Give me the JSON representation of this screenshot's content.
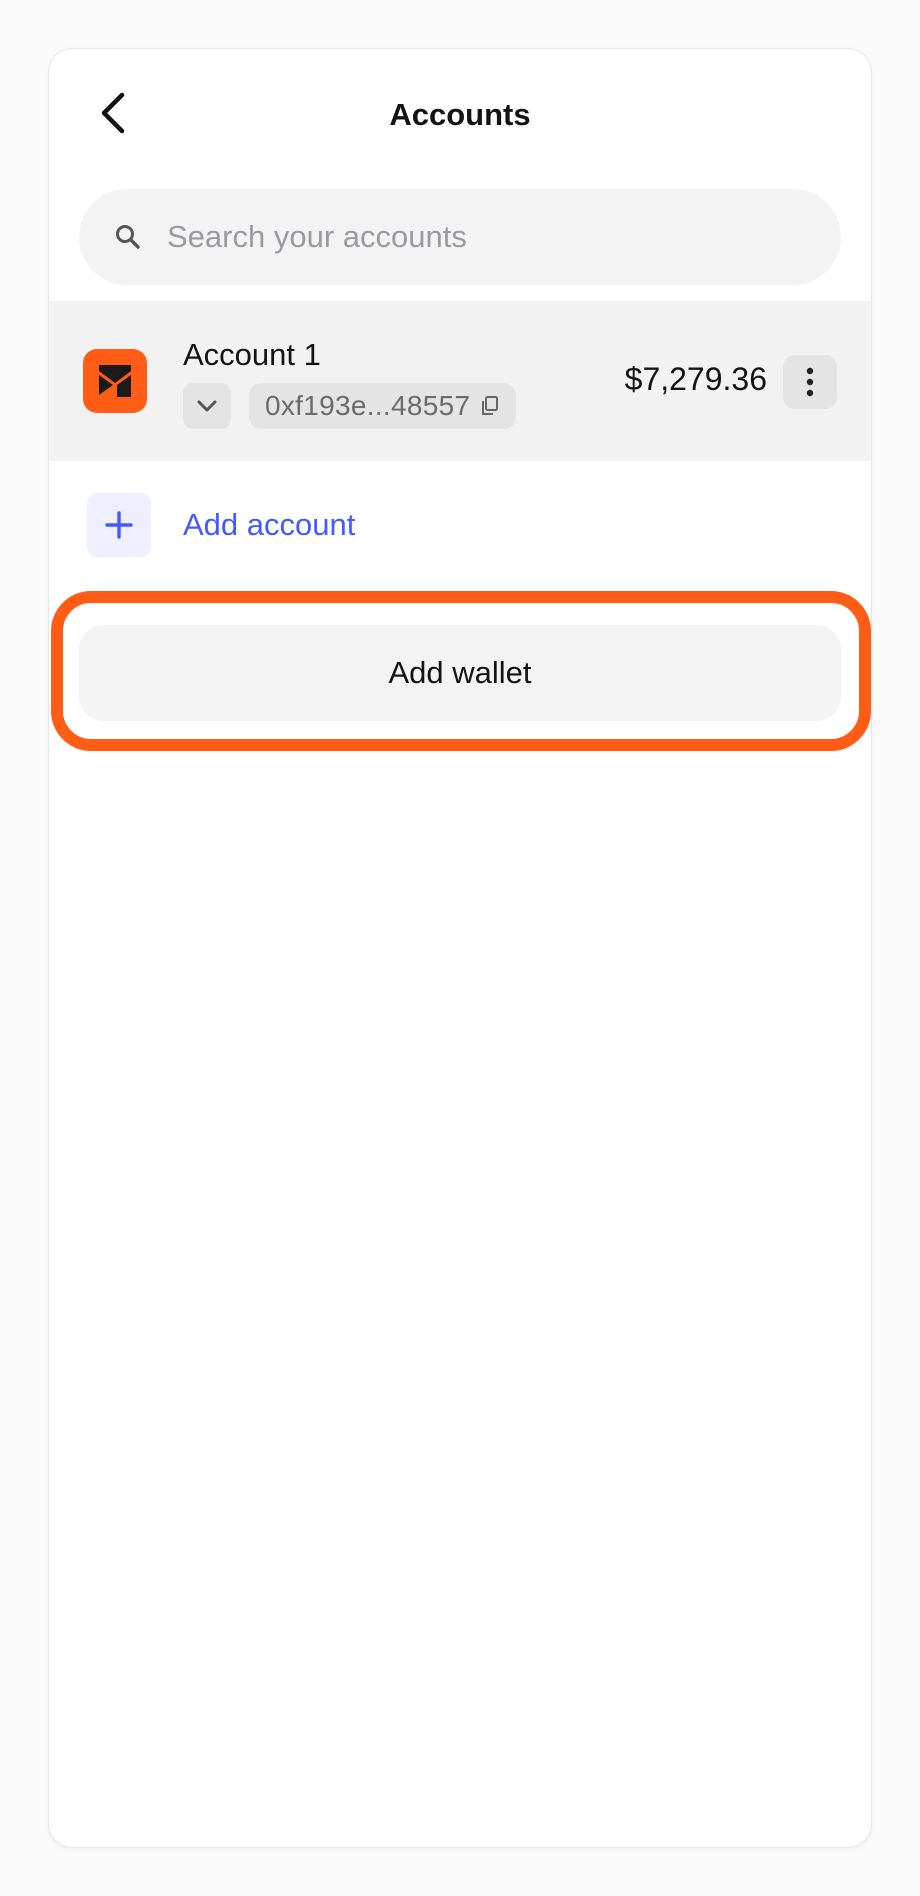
{
  "header": {
    "title": "Accounts",
    "back_icon": "chevron-left-icon"
  },
  "search": {
    "placeholder": "Search your accounts",
    "value": "",
    "icon": "search-icon"
  },
  "accounts": [
    {
      "name": "Account 1",
      "address": "0xf193e...48557",
      "balance": "$7,279.36",
      "avatar_color": "#ff5c16",
      "icons": [
        "chevron-down-icon",
        "copy-icon",
        "more-vertical-icon"
      ]
    }
  ],
  "add_account": {
    "label": "Add account",
    "icon": "plus-icon",
    "color": "#4459ff"
  },
  "add_wallet": {
    "label": "Add wallet"
  },
  "colors": {
    "accent": "#ff5c16",
    "link": "#4459ff"
  }
}
